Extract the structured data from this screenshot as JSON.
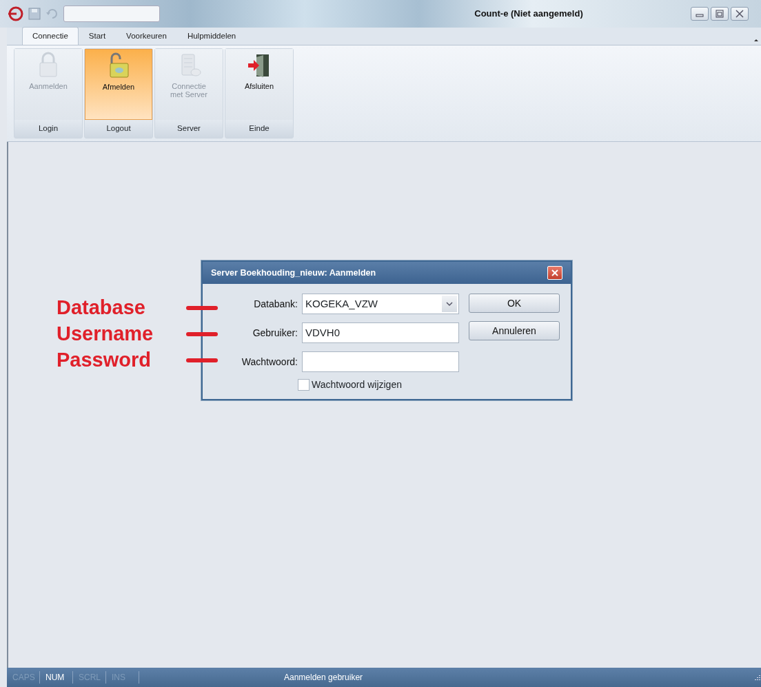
{
  "window": {
    "title": "Count-e (Niet aangemeld)"
  },
  "tabs": [
    {
      "label": "Connectie",
      "selected": true
    },
    {
      "label": "Start",
      "selected": false
    },
    {
      "label": "Voorkeuren",
      "selected": false
    },
    {
      "label": "Hulpmiddelen",
      "selected": false
    }
  ],
  "ribbon": {
    "groups": [
      {
        "label": "Login",
        "button": {
          "label": "Aanmelden",
          "kind": "lock",
          "disabled": true,
          "hot": false
        }
      },
      {
        "label": "Logout",
        "button": {
          "label": "Afmelden",
          "kind": "unlock",
          "disabled": false,
          "hot": true
        }
      },
      {
        "label": "Server",
        "button": {
          "label": "Connectie met Server",
          "kind": "server",
          "disabled": true,
          "hot": false
        }
      },
      {
        "label": "Einde",
        "button": {
          "label": "Afsluiten",
          "kind": "exit",
          "disabled": false,
          "hot": false
        }
      }
    ]
  },
  "dialog": {
    "title": "Server Boekhouding_nieuw: Aanmelden",
    "fields": [
      {
        "kind": "combo",
        "label": "Databank:",
        "value": "KOGEKA_VZW"
      },
      {
        "kind": "text",
        "label": "Gebruiker:",
        "value": "VDVH0"
      },
      {
        "kind": "password",
        "label": "Wachtwoord:"
      }
    ],
    "buttons": [
      "OK",
      "Annuleren"
    ],
    "checkbox": {
      "label": "Wachtwoord wijzigen",
      "checked": false
    }
  },
  "annotations": [
    {
      "label": "Database"
    },
    {
      "label": "Username"
    },
    {
      "label": "Password"
    }
  ],
  "status_bar": {
    "indicators": [
      {
        "label": "CAPS",
        "on": false
      },
      {
        "label": "NUM",
        "on": true
      },
      {
        "label": "SCRL",
        "on": false
      },
      {
        "label": "INS",
        "on": false
      }
    ],
    "message": "Aanmelden gebruiker"
  }
}
